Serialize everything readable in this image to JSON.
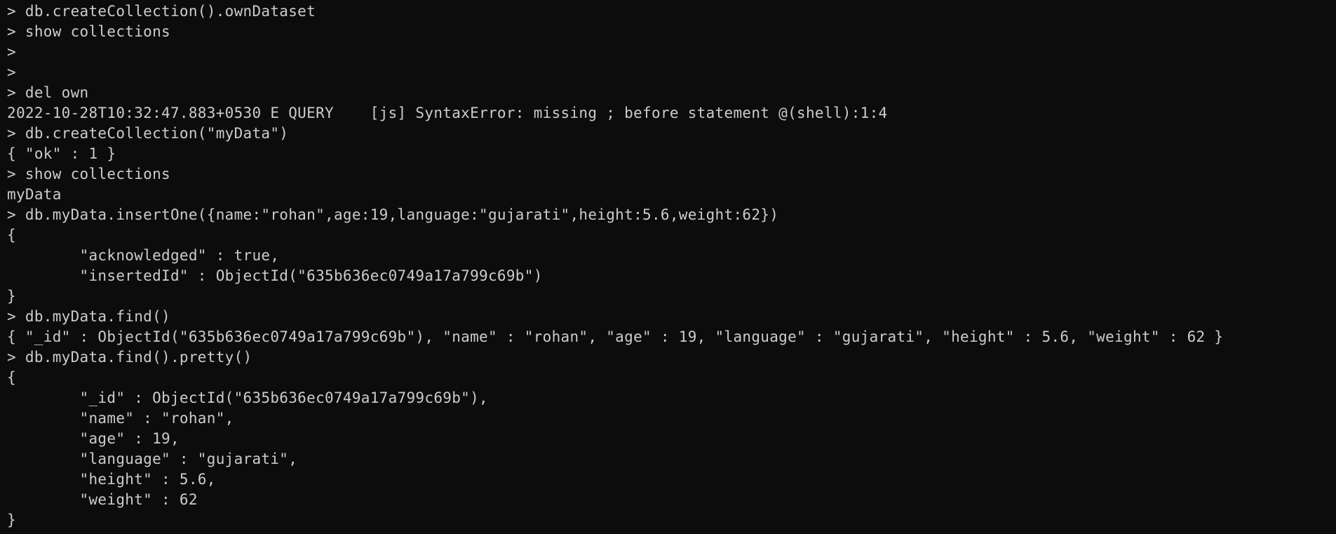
{
  "terminal": {
    "lines": [
      "> db.createCollection().ownDataset",
      "> show collections",
      ">",
      ">",
      "> del own",
      "2022-10-28T10:32:47.883+0530 E QUERY    [js] SyntaxError: missing ; before statement @(shell):1:4",
      "> db.createCollection(\"myData\")",
      "{ \"ok\" : 1 }",
      "> show collections",
      "myData",
      "> db.myData.insertOne({name:\"rohan\",age:19,language:\"gujarati\",height:5.6,weight:62})",
      "{",
      "        \"acknowledged\" : true,",
      "        \"insertedId\" : ObjectId(\"635b636ec0749a17a799c69b\")",
      "}",
      "> db.myData.find()",
      "{ \"_id\" : ObjectId(\"635b636ec0749a17a799c69b\"), \"name\" : \"rohan\", \"age\" : 19, \"language\" : \"gujarati\", \"height\" : 5.6, \"weight\" : 62 }",
      "> db.myData.find().pretty()",
      "{",
      "        \"_id\" : ObjectId(\"635b636ec0749a17a799c69b\"),",
      "        \"name\" : \"rohan\",",
      "        \"age\" : 19,",
      "        \"language\" : \"gujarati\",",
      "        \"height\" : 5.6,",
      "        \"weight\" : 62",
      "}"
    ],
    "colors": {
      "background": "#0c0c0c",
      "foreground": "#cccccc"
    }
  }
}
